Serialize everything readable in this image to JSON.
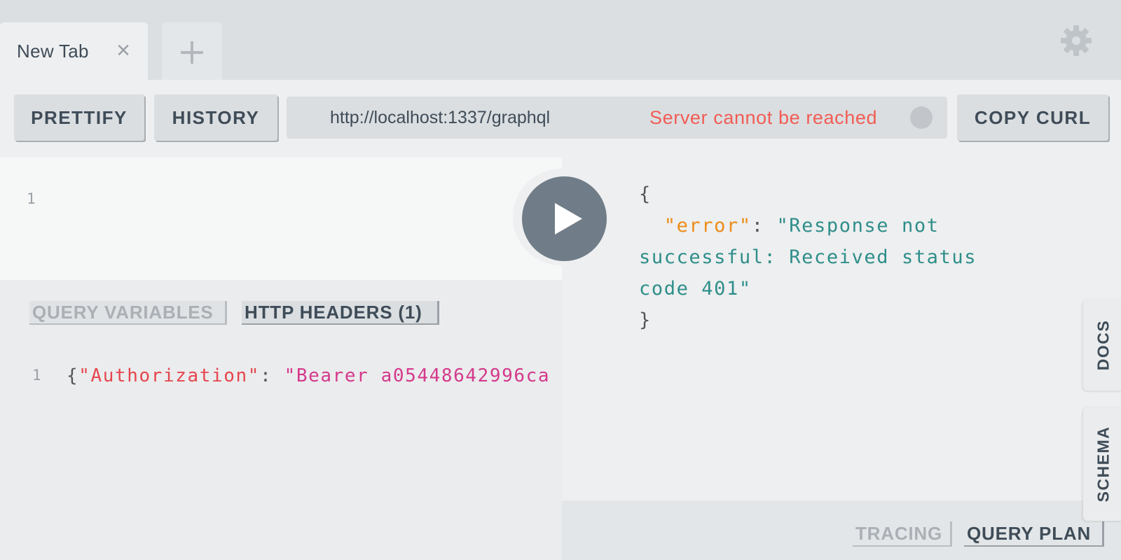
{
  "tabs": [
    {
      "title": "New Tab",
      "close_icon": "close-icon"
    }
  ],
  "new_tab_icon": "plus-icon",
  "settings_icon": "gear-icon",
  "toolbar": {
    "prettify_label": "PRETTIFY",
    "history_label": "HISTORY",
    "copy_curl_label": "COPY CURL",
    "endpoint_url": "http://localhost:1337/graphql",
    "server_status": "Server cannot be reached"
  },
  "query_editor": {
    "line_numbers": [
      "1"
    ],
    "content": ""
  },
  "play_icon": "play-icon",
  "variables_panel": {
    "tab_query_variables": "QUERY VARIABLES",
    "tab_http_headers": "HTTP HEADERS (1)",
    "line_numbers": [
      "1"
    ],
    "headers_open": "{",
    "headers_key": "\"Authorization\"",
    "headers_sep": ": ",
    "headers_value": "\"Bearer a05448642996ca"
  },
  "result": {
    "open_brace": "{",
    "indent": "  ",
    "error_key": "\"error\"",
    "sep": ": ",
    "error_value_line1": "\"Response not",
    "error_value_line2": "successful: Received status",
    "error_value_line3": "code 401\"",
    "close_brace": "}"
  },
  "result_footer": {
    "tracing_label": "TRACING",
    "query_plan_label": "QUERY PLAN"
  },
  "side_tabs": {
    "docs_label": "DOCS",
    "schema_label": "SCHEMA"
  },
  "colors": {
    "status_error": "#f25c54",
    "json_key": "#ec8c1a",
    "json_string": "#2e8e8a",
    "header_key": "#e5464e",
    "header_value": "#d4398c",
    "play_button": "#707d88"
  }
}
